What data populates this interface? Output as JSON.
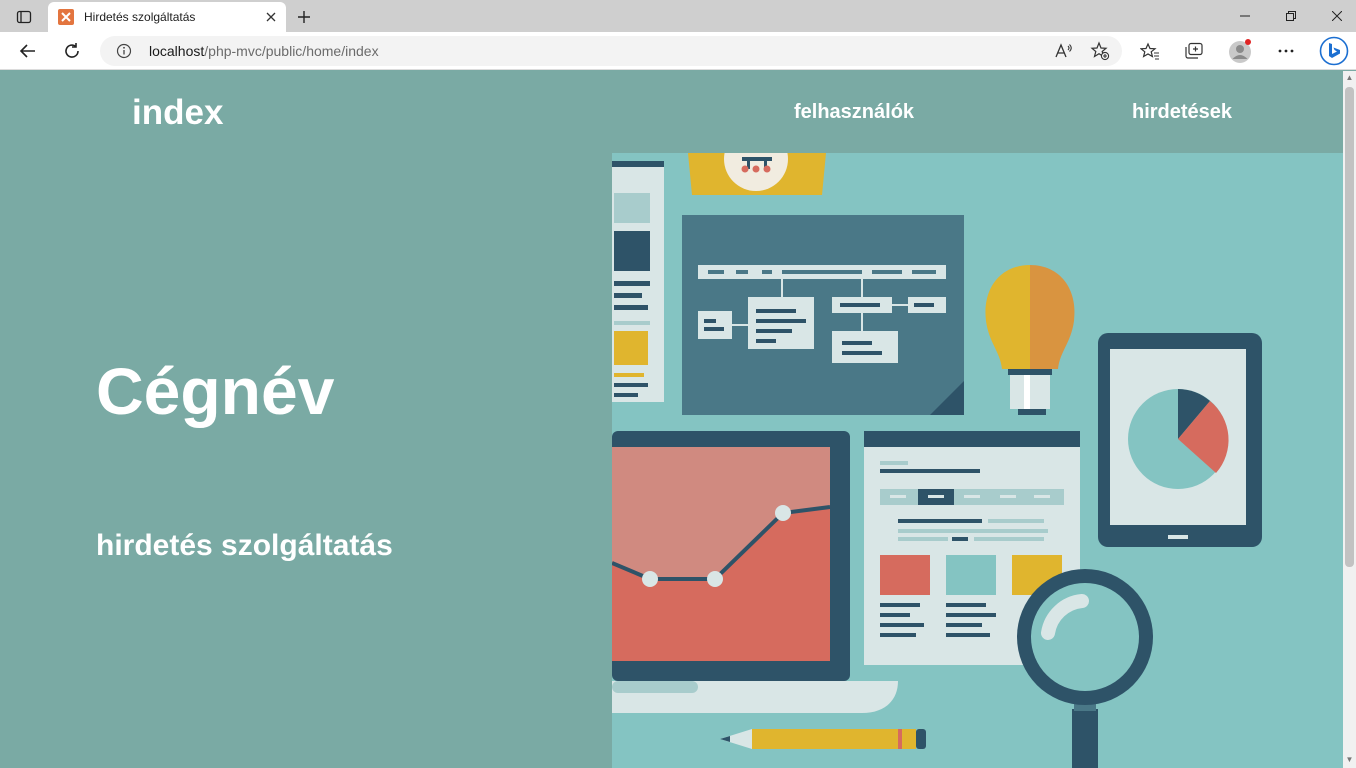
{
  "browser": {
    "tab": {
      "title": "Hirdetés szolgáltatás"
    },
    "url": {
      "host": "localhost",
      "path": "/php-mvc/public/home/index"
    }
  },
  "site": {
    "logo": "index",
    "nav": [
      {
        "label": "felhasználók"
      },
      {
        "label": "hirdetések"
      }
    ],
    "hero": {
      "title": "Cégnév",
      "subtitle": "hirdetés szolgáltatás"
    }
  },
  "colors": {
    "page_background": "#7aaaa4",
    "illustration_background": "#84c4c2",
    "accent_red": "#d66b5e",
    "accent_yellow": "#e0b52e",
    "dark_blue": "#2e5368"
  },
  "icons": [
    "tab-actions-icon",
    "favicon-icon",
    "close-icon",
    "plus-icon",
    "minimize-icon",
    "restore-icon",
    "window-close-icon",
    "back-icon",
    "refresh-icon",
    "info-icon",
    "read-aloud-icon",
    "add-favorite-icon",
    "favorites-icon",
    "collections-icon",
    "profile-icon",
    "more-icon",
    "bing-icon"
  ]
}
